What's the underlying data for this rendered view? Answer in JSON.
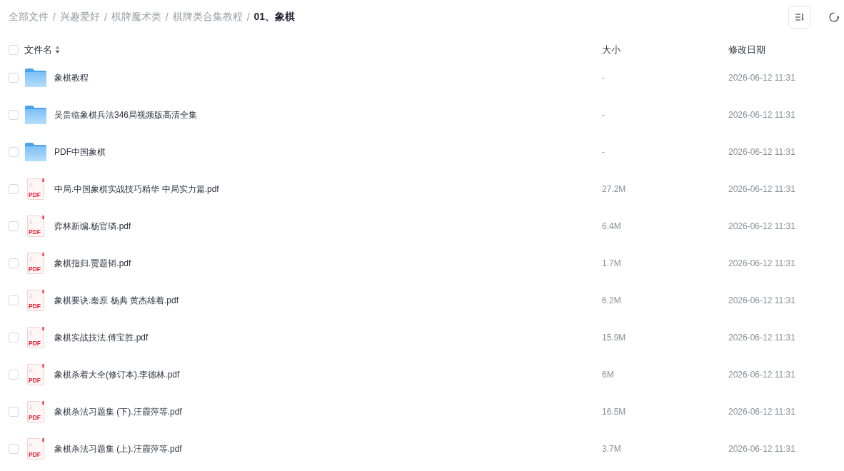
{
  "toolbar": {
    "breadcrumb": [
      {
        "kind": "crumb",
        "label": "全部文件",
        "current": false
      },
      {
        "kind": "separator",
        "label": "/"
      },
      {
        "kind": "crumb",
        "label": "兴趣爱好",
        "current": false
      },
      {
        "kind": "separator",
        "label": "/"
      },
      {
        "kind": "crumb",
        "label": "棋牌魔术类",
        "current": false
      },
      {
        "kind": "separator",
        "label": "/"
      },
      {
        "kind": "crumb",
        "label": "棋牌类合集教程",
        "current": false
      },
      {
        "kind": "separator",
        "label": "/"
      },
      {
        "kind": "crumb",
        "label": "01、象棋",
        "current": true
      }
    ]
  },
  "table": {
    "select_all": {
      "checked": false
    },
    "columns": [
      {
        "label": "文件名",
        "sortable": true
      },
      {
        "label": "大小",
        "sortable": false
      },
      {
        "label": "修改日期",
        "sortable": false
      }
    ],
    "rows": [
      {
        "kind": "folder",
        "name": "象棋教程",
        "size": "-",
        "modified": "2026-06-12 11:31",
        "checked": false
      },
      {
        "kind": "folder",
        "name": "吴贵临象棋兵法346局视频版高清全集",
        "size": "-",
        "modified": "2026-06-12 11:31",
        "checked": false
      },
      {
        "kind": "folder",
        "name": "PDF中国象棋",
        "size": "-",
        "modified": "2026-06-12 11:31",
        "checked": false
      },
      {
        "kind": "pdf",
        "icon_text": "PDF",
        "name": "中局.中国象棋实战技巧精华 中局实力篇.pdf",
        "size": "27.2M",
        "modified": "2026-06-12 11:31",
        "checked": false
      },
      {
        "kind": "pdf",
        "icon_text": "PDF",
        "name": "弈林新编.杨官璘.pdf",
        "size": "6.4M",
        "modified": "2026-06-12 11:31",
        "checked": false
      },
      {
        "kind": "pdf",
        "icon_text": "PDF",
        "name": "象棋指归.贾题韬.pdf",
        "size": "1.7M",
        "modified": "2026-06-12 11:31",
        "checked": false
      },
      {
        "kind": "pdf",
        "icon_text": "PDF",
        "name": "象棋要诀.秦原 杨典 黄杰雄着.pdf",
        "size": "6.2M",
        "modified": "2026-06-12 11:31",
        "checked": false
      },
      {
        "kind": "pdf",
        "icon_text": "PDF",
        "name": "象棋实战技法.傅宝胜.pdf",
        "size": "15.9M",
        "modified": "2026-06-12 11:31",
        "checked": false
      },
      {
        "kind": "pdf",
        "icon_text": "PDF",
        "name": "象棋杀着大全(修订本).李德林.pdf",
        "size": "6M",
        "modified": "2026-06-12 11:31",
        "checked": false
      },
      {
        "kind": "pdf",
        "icon_text": "PDF",
        "name": "象棋杀法习题集 (下).汪霞萍等.pdf",
        "size": "16.5M",
        "modified": "2026-06-12 11:31",
        "checked": false
      },
      {
        "kind": "pdf",
        "icon_text": "PDF",
        "name": "象棋杀法习题集 (上).汪霞萍等.pdf",
        "size": "3.7M",
        "modified": "2026-06-12 11:31",
        "checked": false
      }
    ]
  }
}
